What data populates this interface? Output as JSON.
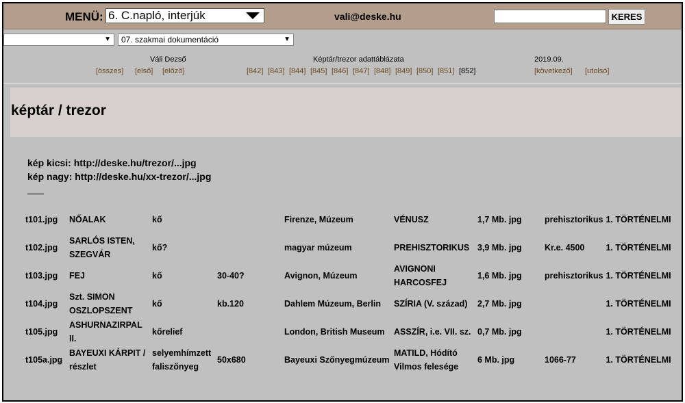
{
  "topbar": {
    "menu_label": "MENÜ:",
    "menu_selected": "6. C.napló, interjúk",
    "email": "vali@deske.hu",
    "search_value": "",
    "search_button": "KERES"
  },
  "selects": {
    "first_value": "",
    "second_value": "07. szakmai dokumentáció"
  },
  "nav": {
    "author": "Váli Dezső",
    "doc_title": "Képtár/trezor adattáblázata",
    "date": "2019.09.",
    "left_links": [
      "[összes]",
      "[első]",
      "[előző]"
    ],
    "page_links": [
      "[842]",
      "[843]",
      "[844]",
      "[845]",
      "[846]",
      "[847]",
      "[848]",
      "[849]",
      "[850]",
      "[851]"
    ],
    "current_page": "[852]",
    "right_links": [
      "[következő]",
      "[utolsó]"
    ]
  },
  "page_title": "képtár / trezor",
  "info": {
    "small": "kép kicsi: http://deske.hu/trezor/...jpg",
    "large": "kép nagy: http://deske.hu/xx-trezor/...jpg"
  },
  "rows": [
    {
      "file": "t101.jpg",
      "title": [
        "NŐALAK"
      ],
      "material": [
        "kő"
      ],
      "size": "",
      "place": "Firenze, Múzeum",
      "period": [
        "VÉNUSZ"
      ],
      "filesize": "1,7 Mb. jpg",
      "date": "prehisztorikus",
      "category": "1. TÖRTÉNELMI"
    },
    {
      "file": "t102.jpg",
      "title": [
        "SARLÓS ISTEN,",
        "SZEGVÁR"
      ],
      "material": [
        "kő?"
      ],
      "size": "",
      "place": "magyar múzeum",
      "period": [
        "PREHISZTORIKUS"
      ],
      "filesize": "3,9 Mb. jpg",
      "date": "Kr.e. 4500",
      "category": "1. TÖRTÉNELMI"
    },
    {
      "file": "t103.jpg",
      "title": [
        "FEJ"
      ],
      "material": [
        "kő"
      ],
      "size": "30-40?",
      "place": "Avignon, Múzeum",
      "period": [
        "AVIGNONI",
        "HARCOSFEJ"
      ],
      "filesize": "1,6 Mb. jpg",
      "date": "prehisztorikus",
      "category": "1. TÖRTÉNELMI"
    },
    {
      "file": "t104.jpg",
      "title": [
        "Szt. SIMON",
        "OSZLOPSZENT"
      ],
      "material": [
        "kő"
      ],
      "size": "kb.120",
      "place": "Dahlem Múzeum, Berlin",
      "period": [
        "SZÍRIA (V. század)"
      ],
      "filesize": "2,7 Mb. jpg",
      "date": "",
      "category": "1. TÖRTÉNELMI"
    },
    {
      "file": "t105.jpg",
      "title": [
        "ASHURNAZIRPAL",
        "II."
      ],
      "material": [
        "kőrelief"
      ],
      "size": "",
      "place": "London, British Museum",
      "period": [
        "ASSZÍR, i.e. VII. sz."
      ],
      "filesize": "0,7 Mb. jpg",
      "date": "",
      "category": "1. TÖRTÉNELMI"
    },
    {
      "file": "t105a.jpg",
      "title": [
        "BAYEUXI KÁRPIT /",
        "részlet"
      ],
      "material": [
        "selyemhímzett",
        "faliszőnyeg"
      ],
      "size": "50x680",
      "place": "Bayeuxi Szőnyegmúzeum",
      "period": [
        "MATILD, Hódító",
        "Vilmos felesége"
      ],
      "filesize": "6 Mb. jpg",
      "date": "1066-77",
      "category": "1. TÖRTÉNELMI"
    }
  ]
}
